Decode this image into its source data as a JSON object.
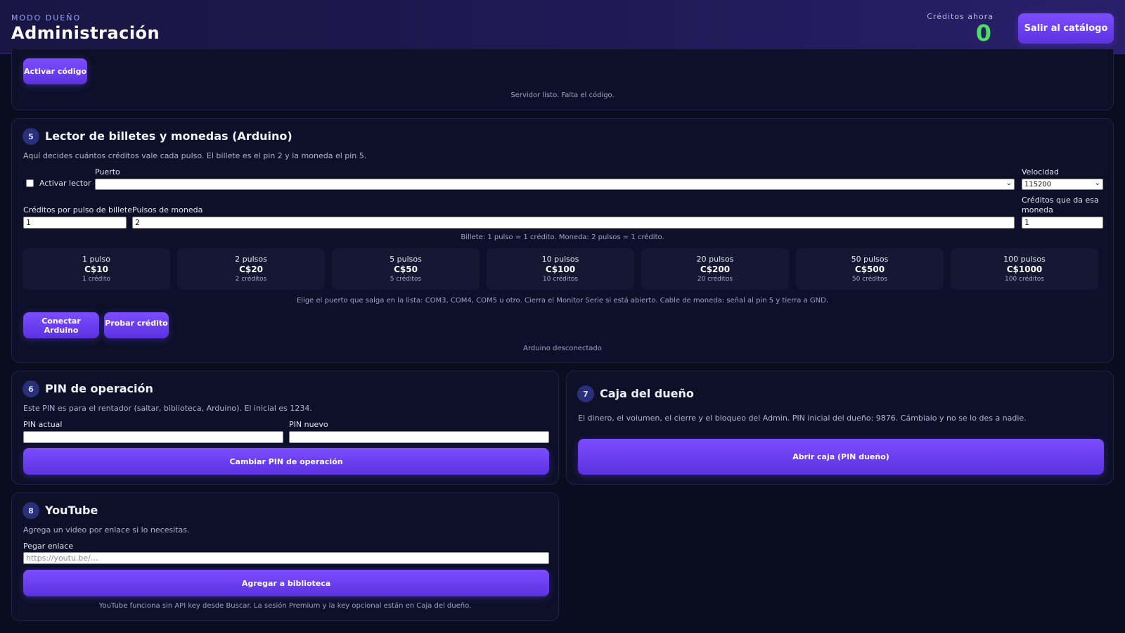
{
  "header": {
    "mode_label": "MODO DUEÑO",
    "title": "Administración",
    "credits_label": "Créditos ahora",
    "credits_value": "0",
    "exit_label": "Salir al catálogo"
  },
  "activation": {
    "button_label": "Activar código",
    "status": "Servidor listo. Falta el código."
  },
  "reader": {
    "number": "5",
    "title": "Lector de billetes y monedas (Arduino)",
    "description": "Aquí decides cuántos créditos vale cada pulso. El billete es el pin 2 y la moneda el pin 5.",
    "enable_label": "Activar lector",
    "port_label": "Puerto",
    "port_value": "",
    "speed_label": "Velocidad",
    "speed_value": "115200",
    "bill_credits_label": "Créditos por pulso de billete",
    "bill_credits_value": "1",
    "coin_pulses_label": "Pulsos de moneda",
    "coin_pulses_value": "2",
    "coin_credits_label": "Créditos que da esa moneda",
    "coin_credits_value": "1",
    "summary": "Billete: 1 pulso = 1 crédito. Moneda: 2 pulsos = 1 crédito.",
    "pulses": [
      {
        "pulses": "1 pulso",
        "amount": "C$10",
        "credits": "1 crédito"
      },
      {
        "pulses": "2 pulsos",
        "amount": "C$20",
        "credits": "2 créditos"
      },
      {
        "pulses": "5 pulsos",
        "amount": "C$50",
        "credits": "5 créditos"
      },
      {
        "pulses": "10 pulsos",
        "amount": "C$100",
        "credits": "10 créditos"
      },
      {
        "pulses": "20 pulsos",
        "amount": "C$200",
        "credits": "20 créditos"
      },
      {
        "pulses": "50 pulsos",
        "amount": "C$500",
        "credits": "50 créditos"
      },
      {
        "pulses": "100 pulsos",
        "amount": "C$1000",
        "credits": "100 créditos"
      }
    ],
    "hint": "Elige el puerto que salga en la lista: COM3, COM4, COM5 u otro. Cierra el Monitor Serie si está abierto. Cable de moneda: señal al pin 5 y tierra a GND.",
    "connect_label": "Conectar Arduino",
    "test_label": "Probar crédito",
    "status": "Arduino desconectado"
  },
  "pin": {
    "number": "6",
    "title": "PIN de operación",
    "description": "Este PIN es para el rentador (saltar, biblioteca, Arduino). El inicial es 1234.",
    "current_label": "PIN actual",
    "current_value": "",
    "new_label": "PIN nuevo",
    "new_value": "",
    "button_label": "Cambiar PIN de operación"
  },
  "owner_box": {
    "number": "7",
    "title": "Caja del dueño",
    "description": "El dinero, el volumen, el cierre y el bloqueo del Admin. PIN inicial del dueño: 9876. Cámbialo y no se lo des a nadie.",
    "button_label": "Abrir caja (PIN dueño)"
  },
  "youtube": {
    "number": "8",
    "title": "YouTube",
    "description": "Agrega un video por enlace si lo necesitas.",
    "link_label": "Pegar enlace",
    "link_value": "",
    "link_placeholder": "https://youtu.be/...",
    "button_label": "Agregar a biblioteca",
    "note": "YouTube funciona sin API key desde Buscar. La sesión Premium y la key opcional están en Caja del dueño."
  }
}
